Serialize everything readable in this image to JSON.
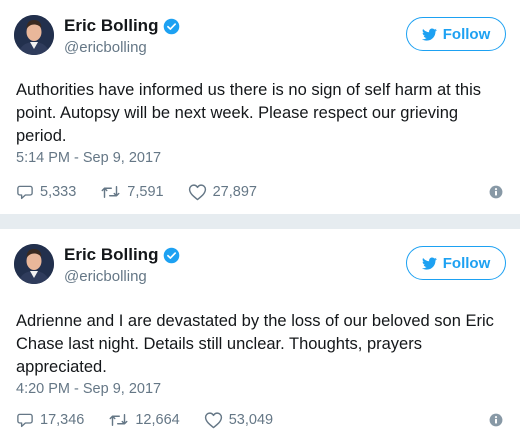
{
  "tweets": [
    {
      "name": "Eric Bolling",
      "handle": "@ericbolling",
      "follow_label": "Follow",
      "text": "Authorities have informed us there is no sign of self harm at this point. Autopsy will be next week. Please respect our grieving period.",
      "timestamp": "5:14 PM - Sep 9, 2017",
      "replies": "5,333",
      "retweets": "7,591",
      "likes": "27,897"
    },
    {
      "name": "Eric Bolling",
      "handle": "@ericbolling",
      "follow_label": "Follow",
      "text": "Adrienne and I are devastated by the loss of our beloved son Eric Chase last night. Details still unclear. Thoughts, prayers appreciated.",
      "timestamp": "4:20 PM - Sep 9, 2017",
      "replies": "17,346",
      "retweets": "12,664",
      "likes": "53,049"
    }
  ],
  "colors": {
    "brand_blue": "#1da1f2",
    "text_primary": "#14171a",
    "text_secondary": "#657786",
    "divider": "#e6ecf0"
  },
  "icons": [
    "verified-badge-icon",
    "twitter-bird-icon",
    "reply-icon",
    "retweet-icon",
    "like-heart-icon",
    "info-icon"
  ]
}
